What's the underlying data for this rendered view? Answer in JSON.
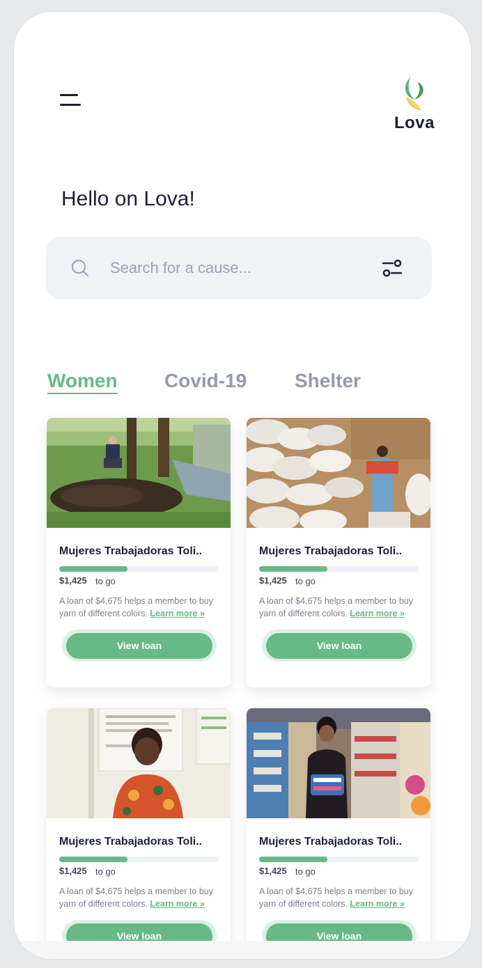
{
  "app": {
    "logo_text": "Lova"
  },
  "greeting": "Hello on Lova!",
  "search": {
    "placeholder": "Search for a cause..."
  },
  "tabs": [
    {
      "label": "Women",
      "active": true
    },
    {
      "label": "Covid-19",
      "active": false
    },
    {
      "label": "Shelter",
      "active": false
    }
  ],
  "colors": {
    "accent": "#67b987",
    "text_dark": "#1d1f33",
    "muted": "#9799ac"
  },
  "cards": [
    {
      "title": "Mujeres Trabajadoras Toli..",
      "amount": "$1,425",
      "to_go": "to go",
      "progress": 0.43,
      "description": "A loan of $4,675 helps a member to buy yarn of different colors.",
      "learn_more": "Learn more »",
      "button": "View loan"
    },
    {
      "title": "Mujeres Trabajadoras Toli..",
      "amount": "$1,425",
      "to_go": "to go",
      "progress": 0.43,
      "description": "A loan of $4,675 helps a member to buy yarn of different colors.",
      "learn_more": "Learn more »",
      "button": "View loan"
    },
    {
      "title": "Mujeres Trabajadoras Toli..",
      "amount": "$1,425",
      "to_go": "to go",
      "progress": 0.43,
      "description": "A loan of $4,675 helps a member to buy yarn of different colors.",
      "learn_more": "Learn more »",
      "button": "View loan"
    },
    {
      "title": "Mujeres Trabajadoras Toli..",
      "amount": "$1,425",
      "to_go": "to go",
      "progress": 0.43,
      "description": "A loan of $4,675 helps a member to buy yarn of different colors.",
      "learn_more": "Learn more »",
      "button": "View loan"
    }
  ]
}
